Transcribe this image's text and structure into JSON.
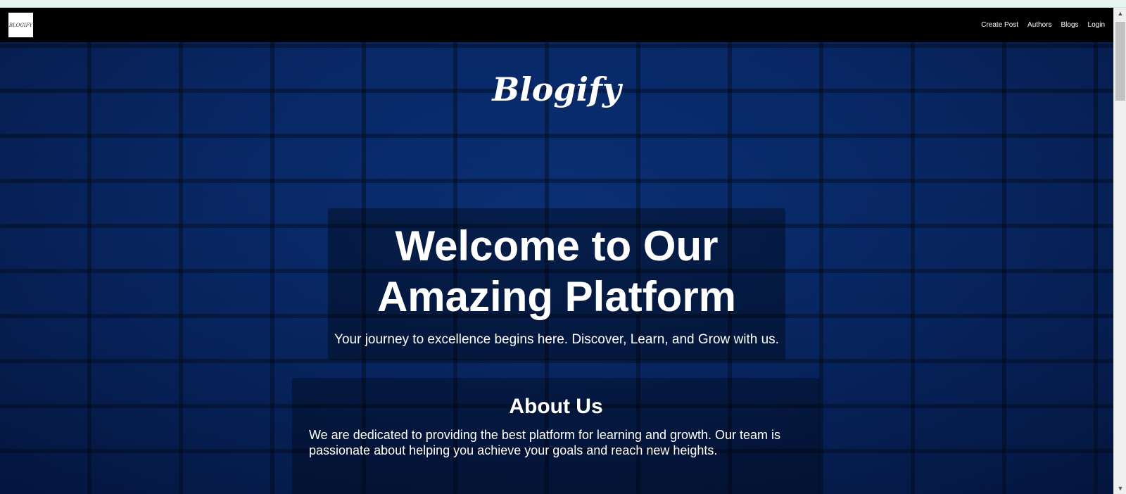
{
  "navbar": {
    "logo_text": "BLOGIFY",
    "links": [
      "Create Post",
      "Authors",
      "Blogs",
      "Login"
    ]
  },
  "hero": {
    "brand": "Blogify",
    "welcome_title": "Welcome to Our Amazing Platform",
    "welcome_subtitle": "Your journey to excellence begins here. Discover, Learn, and Grow with us."
  },
  "about": {
    "title": "About Us",
    "text": "We are dedicated to providing the best platform for learning and growth. Our team is passionate about helping you achieve your goals and reach new heights."
  },
  "colors": {
    "navbar": "#000000",
    "hero_blue": "#0b2a6b"
  },
  "icons": {
    "scroll_up": "triangle-up-icon",
    "scroll_down": "triangle-down-icon"
  }
}
